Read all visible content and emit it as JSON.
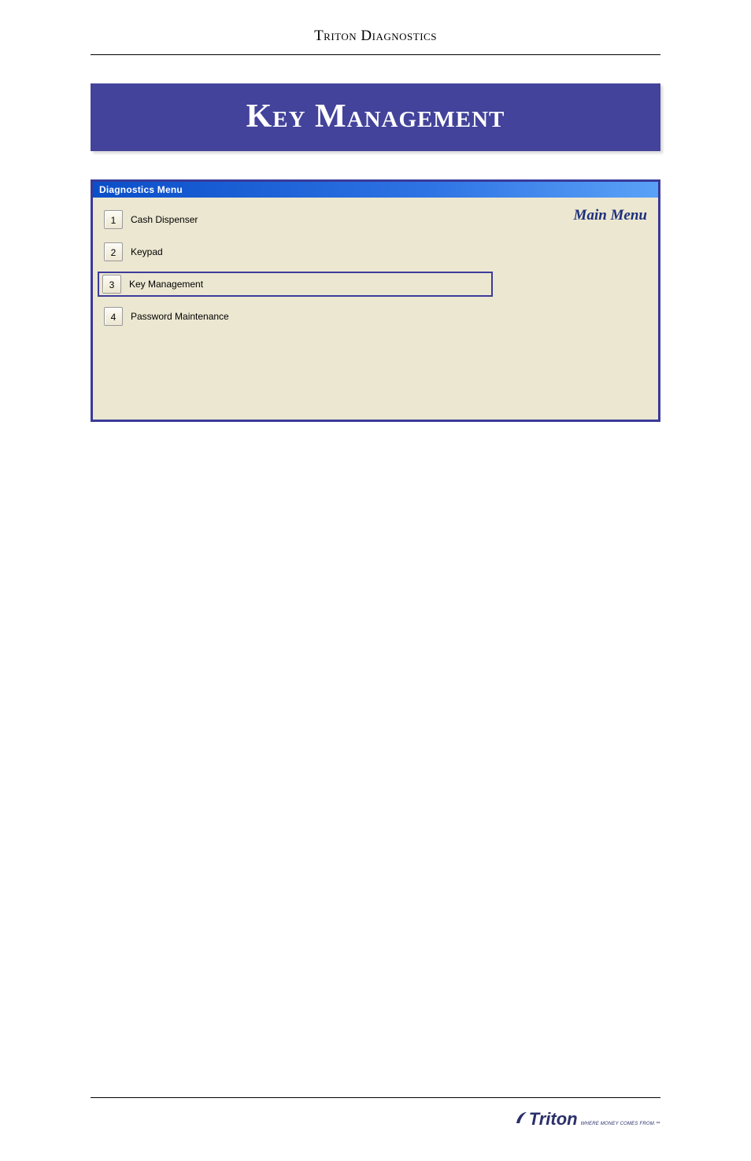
{
  "header": {
    "section": "Triton Diagnostics"
  },
  "title": "Key Management",
  "window": {
    "titlebar": "Diagnostics Menu",
    "main_menu_label": "Main Menu",
    "items": [
      {
        "num": "1",
        "label": "Cash Dispenser",
        "selected": false
      },
      {
        "num": "2",
        "label": "Keypad",
        "selected": false
      },
      {
        "num": "3",
        "label": "Key Management",
        "selected": true
      },
      {
        "num": "4",
        "label": "Password Maintenance",
        "selected": false
      }
    ]
  },
  "footer": {
    "logo_text": "Triton",
    "logo_tag": "WHERE MONEY COMES FROM.™"
  }
}
